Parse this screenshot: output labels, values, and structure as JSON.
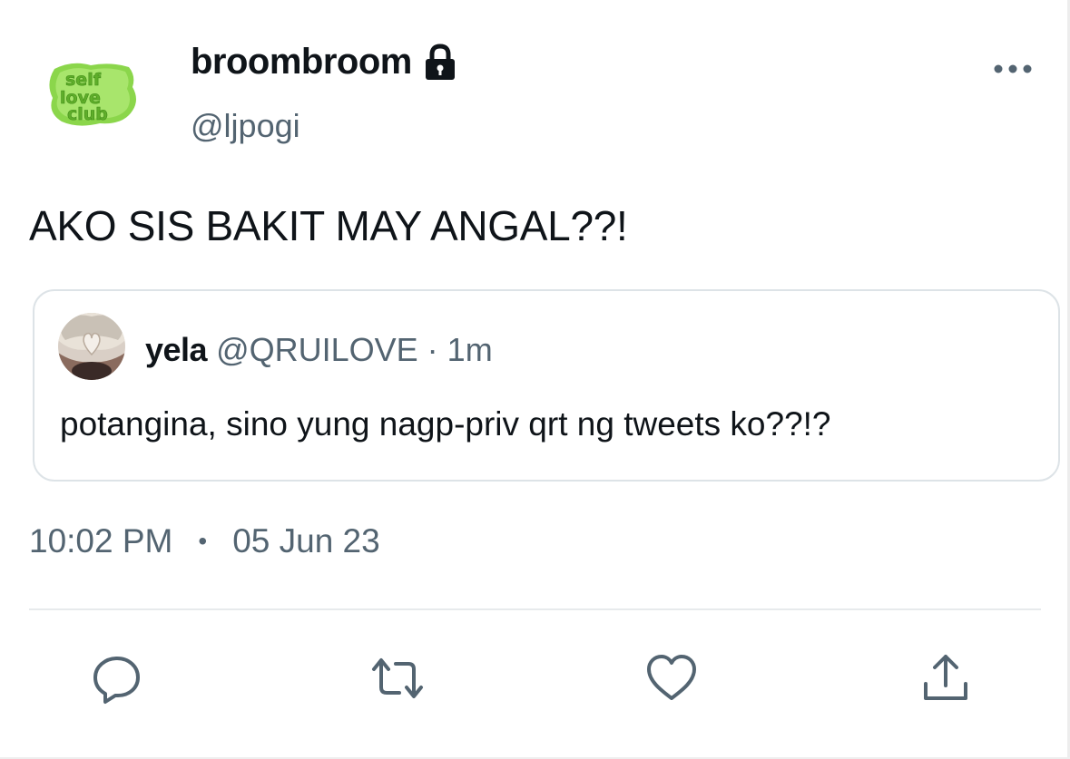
{
  "author": {
    "display_name": "broombroom",
    "handle": "@ljpogi",
    "avatar_text": [
      "self",
      "love",
      "club"
    ],
    "avatar_color": "#8bd64b"
  },
  "tweet": {
    "text": "AKO SIS BAKIT MAY ANGAL??!"
  },
  "quoted": {
    "display_name": "yela",
    "handle": "@QRUILOVE",
    "separator": "·",
    "time": "1m",
    "text": "potangina, sino yung nagp-priv qrt ng tweets ko??!?"
  },
  "meta": {
    "time": "10:02 PM",
    "separator": "•",
    "date": "05 Jun 23"
  },
  "actions": [
    "reply-icon",
    "retweet-icon",
    "like-icon",
    "share-icon"
  ],
  "colors": {
    "text": "#0f1419",
    "secondary": "#536471",
    "border": "#dde3e7"
  }
}
